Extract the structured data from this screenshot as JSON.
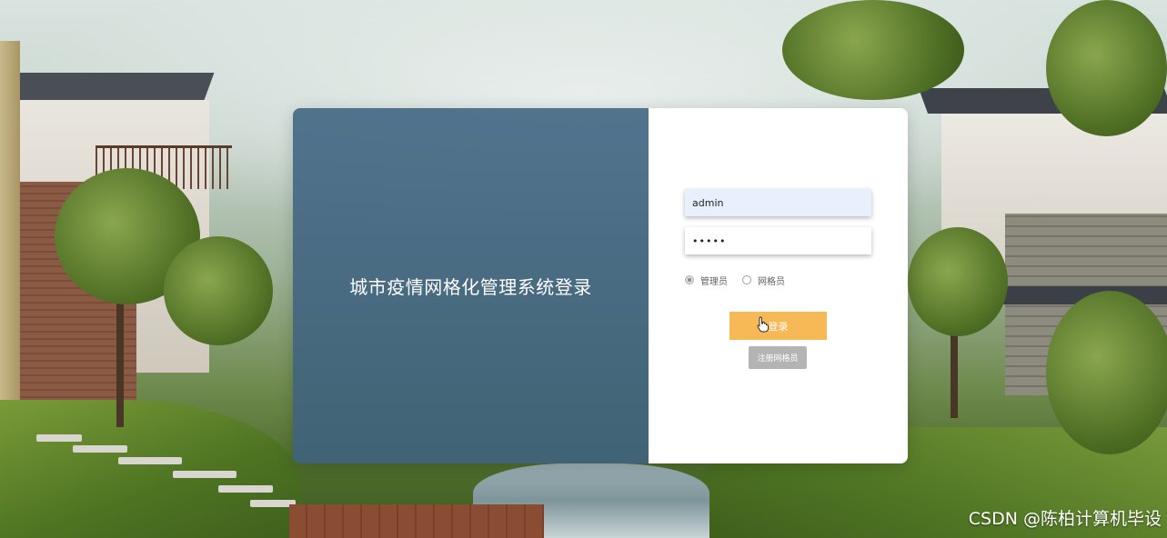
{
  "login": {
    "title": "城市疫情网格化管理系统登录",
    "username_value": "admin",
    "password_value": "•••••",
    "roles": [
      {
        "label": "管理员",
        "checked": true
      },
      {
        "label": "网格员",
        "checked": false
      }
    ],
    "login_button_label": "登录",
    "register_button_label": "注册网格员"
  },
  "watermark": "CSDN @陈柏计算机毕设",
  "colors": {
    "left_panel": "#3e6280",
    "login_button": "#f7b955",
    "register_button": "#b4b4b4",
    "username_field_bg": "#e8f0fe"
  },
  "icons": {
    "cursor": "hand-pointer-icon"
  }
}
